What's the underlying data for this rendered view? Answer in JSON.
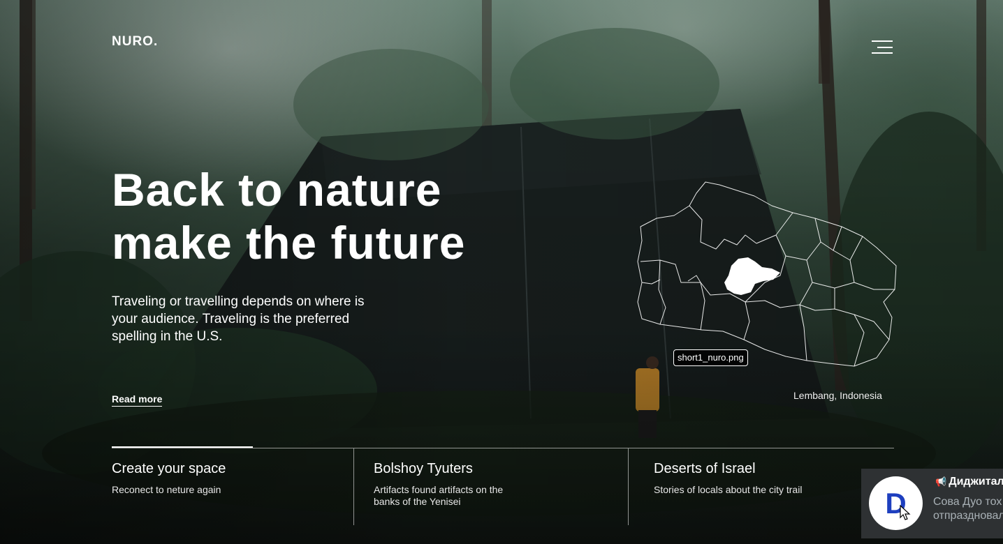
{
  "brand": {
    "logo": "NURO."
  },
  "hero": {
    "headline_line1": "Back to nature",
    "headline_line2": "make the future",
    "intro": "Traveling or travelling depends on where is your audience. Traveling is the preferred spelling in the U.S.",
    "read_more": "Read more"
  },
  "map": {
    "file_label": "short1_nuro.png",
    "location": "Lembang, Indonesia"
  },
  "cards": [
    {
      "title": "Create your space",
      "text": "Reconect to neture again"
    },
    {
      "title": "Bolshoy Tyuters",
      "text": "Artifacts found artifacts on the banks of the Yenisei"
    },
    {
      "title": "Deserts of Israel",
      "text": "Stories of locals about the city trail"
    }
  ],
  "notification": {
    "avatar_letter": "D",
    "title": "Диджитал",
    "body_line1": "Сова Дуо тох",
    "body_line2": "отпраздновал"
  },
  "icons": {
    "menu": "hamburger-menu-icon",
    "megaphone": "megaphone-icon",
    "cursor": "mouse-pointer-icon"
  },
  "colors": {
    "text": "#ffffff",
    "notification_bg": "#2e3133",
    "avatar_letter": "#1e3fbf"
  }
}
